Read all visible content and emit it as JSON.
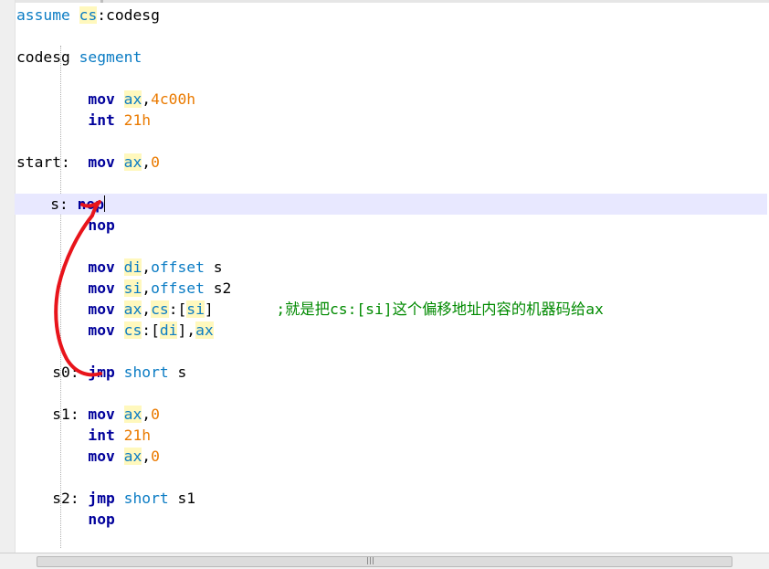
{
  "code_lines": [
    {
      "tokens": [
        {
          "t": "assume",
          "c": "dir"
        },
        {
          "t": " ",
          "c": "pun"
        },
        {
          "t": "cs",
          "c": "reg"
        },
        {
          "t": ":codesg",
          "c": "pun"
        }
      ]
    },
    {
      "tokens": []
    },
    {
      "tokens": [
        {
          "t": "codesg ",
          "c": "pun"
        },
        {
          "t": "segment",
          "c": "dir"
        }
      ]
    },
    {
      "tokens": []
    },
    {
      "tokens": [
        {
          "t": "        ",
          "c": "pun"
        },
        {
          "t": "mov",
          "c": "kw"
        },
        {
          "t": " ",
          "c": "pun"
        },
        {
          "t": "ax",
          "c": "reg"
        },
        {
          "t": ",",
          "c": "pun"
        },
        {
          "t": "4c00h",
          "c": "num"
        }
      ]
    },
    {
      "tokens": [
        {
          "t": "        ",
          "c": "pun"
        },
        {
          "t": "int",
          "c": "kw"
        },
        {
          "t": " ",
          "c": "pun"
        },
        {
          "t": "21h",
          "c": "num"
        }
      ]
    },
    {
      "tokens": []
    },
    {
      "tokens": [
        {
          "t": "start:  ",
          "c": "pun"
        },
        {
          "t": "mov",
          "c": "kw"
        },
        {
          "t": " ",
          "c": "pun"
        },
        {
          "t": "ax",
          "c": "reg"
        },
        {
          "t": ",",
          "c": "pun"
        },
        {
          "t": "0",
          "c": "num"
        }
      ]
    },
    {
      "tokens": []
    },
    {
      "current": true,
      "tokens": [
        {
          "t": "    s: ",
          "c": "pun"
        },
        {
          "t": "nop",
          "c": "kw"
        }
      ]
    },
    {
      "tokens": [
        {
          "t": "        ",
          "c": "pun"
        },
        {
          "t": "nop",
          "c": "kw"
        }
      ]
    },
    {
      "tokens": []
    },
    {
      "tokens": [
        {
          "t": "        ",
          "c": "pun"
        },
        {
          "t": "mov",
          "c": "kw"
        },
        {
          "t": " ",
          "c": "pun"
        },
        {
          "t": "di",
          "c": "reg"
        },
        {
          "t": ",",
          "c": "pun"
        },
        {
          "t": "offset",
          "c": "dir"
        },
        {
          "t": " s",
          "c": "pun"
        }
      ]
    },
    {
      "tokens": [
        {
          "t": "        ",
          "c": "pun"
        },
        {
          "t": "mov",
          "c": "kw"
        },
        {
          "t": " ",
          "c": "pun"
        },
        {
          "t": "si",
          "c": "reg"
        },
        {
          "t": ",",
          "c": "pun"
        },
        {
          "t": "offset",
          "c": "dir"
        },
        {
          "t": " s2",
          "c": "pun"
        }
      ]
    },
    {
      "tokens": [
        {
          "t": "        ",
          "c": "pun"
        },
        {
          "t": "mov",
          "c": "kw"
        },
        {
          "t": " ",
          "c": "pun"
        },
        {
          "t": "ax",
          "c": "reg"
        },
        {
          "t": ",",
          "c": "pun"
        },
        {
          "t": "cs",
          "c": "reg"
        },
        {
          "t": ":[",
          "c": "pun"
        },
        {
          "t": "si",
          "c": "reg"
        },
        {
          "t": "]       ",
          "c": "pun"
        },
        {
          "t": ";就是把cs:[si]这个偏移地址内容的机器码给ax",
          "c": "cmt"
        }
      ]
    },
    {
      "tokens": [
        {
          "t": "        ",
          "c": "pun"
        },
        {
          "t": "mov",
          "c": "kw"
        },
        {
          "t": " ",
          "c": "pun"
        },
        {
          "t": "cs",
          "c": "reg"
        },
        {
          "t": ":[",
          "c": "pun"
        },
        {
          "t": "di",
          "c": "reg"
        },
        {
          "t": "],",
          "c": "pun"
        },
        {
          "t": "ax",
          "c": "reg"
        }
      ]
    },
    {
      "tokens": []
    },
    {
      "tokens": [
        {
          "t": "    s0: ",
          "c": "pun"
        },
        {
          "t": "jmp",
          "c": "kw"
        },
        {
          "t": " ",
          "c": "pun"
        },
        {
          "t": "short",
          "c": "dir"
        },
        {
          "t": " s",
          "c": "pun"
        }
      ]
    },
    {
      "tokens": []
    },
    {
      "tokens": [
        {
          "t": "    s1: ",
          "c": "pun"
        },
        {
          "t": "mov",
          "c": "kw"
        },
        {
          "t": " ",
          "c": "pun"
        },
        {
          "t": "ax",
          "c": "reg"
        },
        {
          "t": ",",
          "c": "pun"
        },
        {
          "t": "0",
          "c": "num"
        }
      ]
    },
    {
      "tokens": [
        {
          "t": "        ",
          "c": "pun"
        },
        {
          "t": "int",
          "c": "kw"
        },
        {
          "t": " ",
          "c": "pun"
        },
        {
          "t": "21h",
          "c": "num"
        }
      ]
    },
    {
      "tokens": [
        {
          "t": "        ",
          "c": "pun"
        },
        {
          "t": "mov",
          "c": "kw"
        },
        {
          "t": " ",
          "c": "pun"
        },
        {
          "t": "ax",
          "c": "reg"
        },
        {
          "t": ",",
          "c": "pun"
        },
        {
          "t": "0",
          "c": "num"
        }
      ]
    },
    {
      "tokens": []
    },
    {
      "tokens": [
        {
          "t": "    s2: ",
          "c": "pun"
        },
        {
          "t": "jmp",
          "c": "kw"
        },
        {
          "t": " ",
          "c": "pun"
        },
        {
          "t": "short",
          "c": "dir"
        },
        {
          "t": " s1",
          "c": "pun"
        }
      ]
    },
    {
      "tokens": [
        {
          "t": "        ",
          "c": "pun"
        },
        {
          "t": "nop",
          "c": "kw"
        }
      ]
    }
  ],
  "colors": {
    "keyword": "#00009b",
    "directive": "#0b7cc4",
    "register_highlight": "#fff8bd",
    "number": "#ea7a00",
    "comment": "#008a00",
    "current_line": "#e8e8ff",
    "annotation_arrow": "#e8141b"
  },
  "annotation": {
    "icon": "hand-drawn-curved-arrow-icon"
  }
}
